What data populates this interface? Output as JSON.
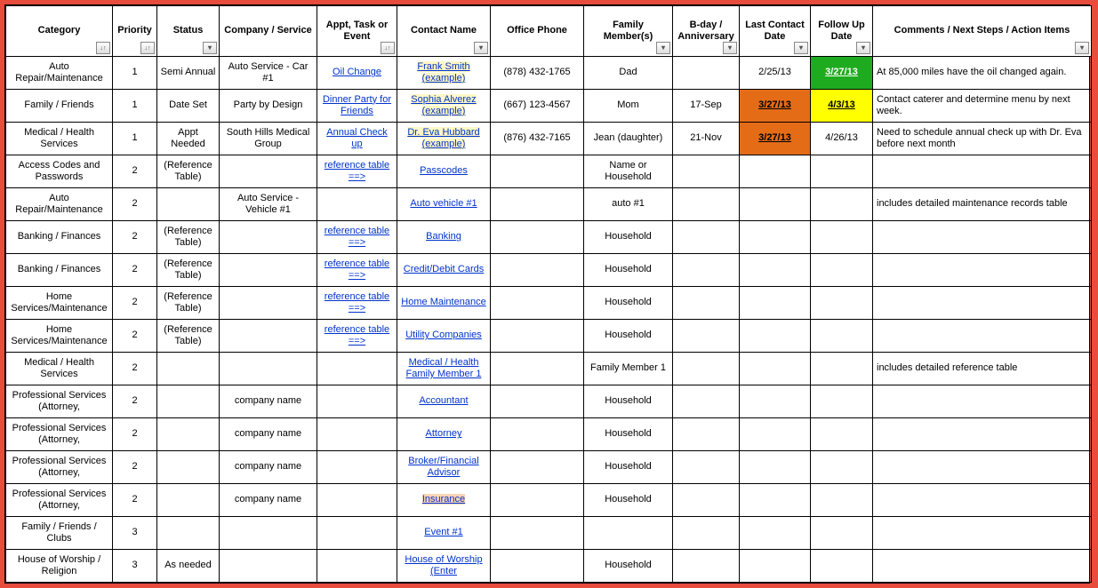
{
  "headers": [
    "Category",
    "Priority",
    "Status",
    "Company / Service",
    "Appt, Task or Event",
    "Contact Name",
    "Office Phone",
    "Family Member(s)",
    "B-day / Anniversary",
    "Last Contact Date",
    "Follow Up Date",
    "Comments / Next Steps / Action Items"
  ],
  "rows": [
    {
      "category": "Auto Repair/Maintenance",
      "priority": "1",
      "status": "Semi Annual",
      "company": "Auto Service - Car #1",
      "appt": "Oil Change",
      "contact": "Frank Smith (example)",
      "contact_hl": "yellow",
      "phone": "(878) 432-1765",
      "family": "Dad",
      "bday": "",
      "last": "2/25/13",
      "last_bg": "",
      "follow": "3/27/13",
      "follow_bg": "green",
      "comments": "At 85,000 miles have the oil changed again."
    },
    {
      "category": "Family / Friends",
      "priority": "1",
      "status": "Date Set",
      "company": "Party by Design",
      "appt": "Dinner Party for Friends",
      "contact": "Sophia Alverez (example)",
      "contact_hl": "yellow",
      "phone": "(667) 123-4567",
      "family": "Mom",
      "bday": "17-Sep",
      "last": "3/27/13",
      "last_bg": "orange",
      "follow": "4/3/13",
      "follow_bg": "yellow",
      "comments": "Contact caterer and determine menu by next week."
    },
    {
      "category": "Medical / Health Services",
      "priority": "1",
      "status": "Appt Needed",
      "company": "South Hills Medical Group",
      "appt": "Annual Check up",
      "contact": "Dr. Eva Hubbard (example)",
      "contact_hl": "yellow",
      "phone": "(876) 432-7165",
      "family": "Jean (daughter)",
      "bday": "21-Nov",
      "last": "3/27/13",
      "last_bg": "orange",
      "follow": "4/26/13",
      "follow_bg": "",
      "comments": "Need to schedule annual check up with Dr. Eva before next month"
    },
    {
      "category": "Access Codes and Passwords",
      "priority": "2",
      "status": "(Reference Table)",
      "company": "",
      "appt": "reference table ==>",
      "contact": "Passcodes",
      "contact_hl": "",
      "phone": "",
      "family": "Name or Household",
      "bday": "",
      "last": "",
      "last_bg": "",
      "follow": "",
      "follow_bg": "",
      "comments": ""
    },
    {
      "category": "Auto Repair/Maintenance",
      "priority": "2",
      "status": "",
      "company": "Auto Service - Vehicle #1",
      "appt": "",
      "contact": "Auto vehicle #1",
      "contact_hl": "",
      "phone": "",
      "family": "auto #1",
      "bday": "",
      "last": "",
      "last_bg": "",
      "follow": "",
      "follow_bg": "",
      "comments": "includes detailed maintenance records table"
    },
    {
      "category": "Banking / Finances",
      "priority": "2",
      "status": "(Reference Table)",
      "company": "",
      "appt": "reference table ==>",
      "contact": "Banking",
      "contact_hl": "",
      "phone": "",
      "family": "Household",
      "bday": "",
      "last": "",
      "last_bg": "",
      "follow": "",
      "follow_bg": "",
      "comments": ""
    },
    {
      "category": "Banking / Finances",
      "priority": "2",
      "status": "(Reference Table)",
      "company": "",
      "appt": "reference table ==>",
      "contact": "Credit/Debit Cards",
      "contact_hl": "",
      "phone": "",
      "family": "Household",
      "bday": "",
      "last": "",
      "last_bg": "",
      "follow": "",
      "follow_bg": "",
      "comments": ""
    },
    {
      "category": "Home Services/Maintenance",
      "priority": "2",
      "status": "(Reference Table)",
      "company": "",
      "appt": "reference table ==>",
      "contact": "Home Maintenance",
      "contact_hl": "",
      "phone": "",
      "family": "Household",
      "bday": "",
      "last": "",
      "last_bg": "",
      "follow": "",
      "follow_bg": "",
      "comments": ""
    },
    {
      "category": "Home Services/Maintenance",
      "priority": "2",
      "status": "(Reference Table)",
      "company": "",
      "appt": "reference table ==>",
      "contact": "Utility Companies",
      "contact_hl": "",
      "phone": "",
      "family": "Household",
      "bday": "",
      "last": "",
      "last_bg": "",
      "follow": "",
      "follow_bg": "",
      "comments": ""
    },
    {
      "category": "Medical / Health Services",
      "priority": "2",
      "status": "",
      "company": "",
      "appt": "",
      "contact": "Medical / Health Family Member 1",
      "contact_hl": "",
      "phone": "",
      "family": "Family Member 1",
      "bday": "",
      "last": "",
      "last_bg": "",
      "follow": "",
      "follow_bg": "",
      "comments": "includes detailed reference table"
    },
    {
      "category": "Professional Services (Attorney,",
      "priority": "2",
      "status": "",
      "company": "company name",
      "appt": "",
      "contact": "Accountant",
      "contact_hl": "",
      "phone": "",
      "family": "Household",
      "bday": "",
      "last": "",
      "last_bg": "",
      "follow": "",
      "follow_bg": "",
      "comments": ""
    },
    {
      "category": "Professional Services (Attorney,",
      "priority": "2",
      "status": "",
      "company": "company name",
      "appt": "",
      "contact": "Attorney",
      "contact_hl": "",
      "phone": "",
      "family": "Household",
      "bday": "",
      "last": "",
      "last_bg": "",
      "follow": "",
      "follow_bg": "",
      "comments": ""
    },
    {
      "category": "Professional Services (Attorney,",
      "priority": "2",
      "status": "",
      "company": "company name",
      "appt": "",
      "contact": "Broker/Financial Advisor",
      "contact_hl": "",
      "phone": "",
      "family": "Household",
      "bday": "",
      "last": "",
      "last_bg": "",
      "follow": "",
      "follow_bg": "",
      "comments": ""
    },
    {
      "category": "Professional Services (Attorney,",
      "priority": "2",
      "status": "",
      "company": "company name",
      "appt": "",
      "contact": "Insurance",
      "contact_hl": "orange",
      "phone": "",
      "family": "Household",
      "bday": "",
      "last": "",
      "last_bg": "",
      "follow": "",
      "follow_bg": "",
      "comments": ""
    },
    {
      "category": "Family / Friends / Clubs",
      "priority": "3",
      "status": "",
      "company": "",
      "appt": "",
      "contact": "Event #1",
      "contact_hl": "",
      "phone": "",
      "family": "",
      "bday": "",
      "last": "",
      "last_bg": "",
      "follow": "",
      "follow_bg": "",
      "comments": ""
    },
    {
      "category": "House of Worship / Religion",
      "priority": "3",
      "status": "As needed",
      "company": "",
      "appt": "",
      "contact": "House of Worship (Enter",
      "contact_hl": "",
      "phone": "",
      "family": "Household",
      "bday": "",
      "last": "",
      "last_bg": "",
      "follow": "",
      "follow_bg": "",
      "comments": ""
    }
  ]
}
